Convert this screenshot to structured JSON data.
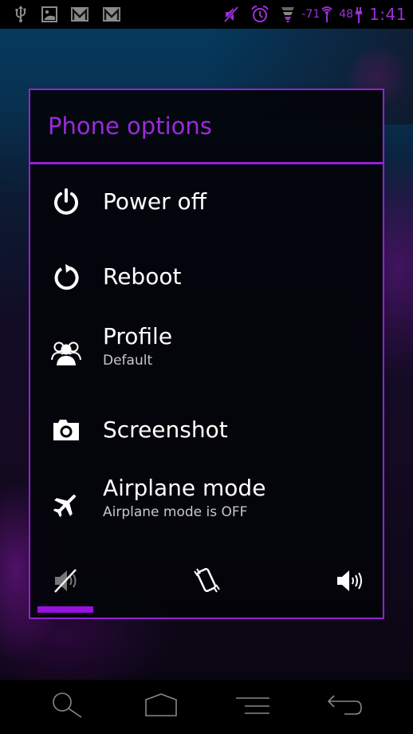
{
  "status_bar": {
    "left_icons": [
      "usb-icon",
      "image-icon",
      "gmail-icon",
      "gmail-icon"
    ],
    "right_icons": [
      "muted-icon",
      "alarm-icon",
      "signal-icon",
      "wifi-icon",
      "battery-icon"
    ],
    "signal_strength": "-71",
    "battery_level": "48",
    "time": "1:41",
    "accent_color": "#9b30d9"
  },
  "dialog": {
    "title": "Phone options",
    "accent_color": "#9421d6",
    "options": [
      {
        "label": "Power off",
        "icon": "power-icon"
      },
      {
        "label": "Reboot",
        "icon": "reboot-icon"
      },
      {
        "label": "Profile",
        "sublabel": "Default",
        "icon": "profile-icon"
      },
      {
        "label": "Screenshot",
        "icon": "camera-icon"
      },
      {
        "label": "Airplane mode",
        "sublabel": "Airplane mode is OFF",
        "icon": "airplane-icon"
      }
    ],
    "sound_modes": [
      {
        "name": "silent",
        "icon": "sound-off-icon",
        "selected": true
      },
      {
        "name": "vibrate",
        "icon": "vibrate-icon",
        "selected": false
      },
      {
        "name": "sound",
        "icon": "sound-on-icon",
        "selected": false
      }
    ]
  },
  "nav_bar": {
    "buttons": [
      "search-icon",
      "home-icon",
      "menu-icon",
      "back-icon"
    ]
  }
}
